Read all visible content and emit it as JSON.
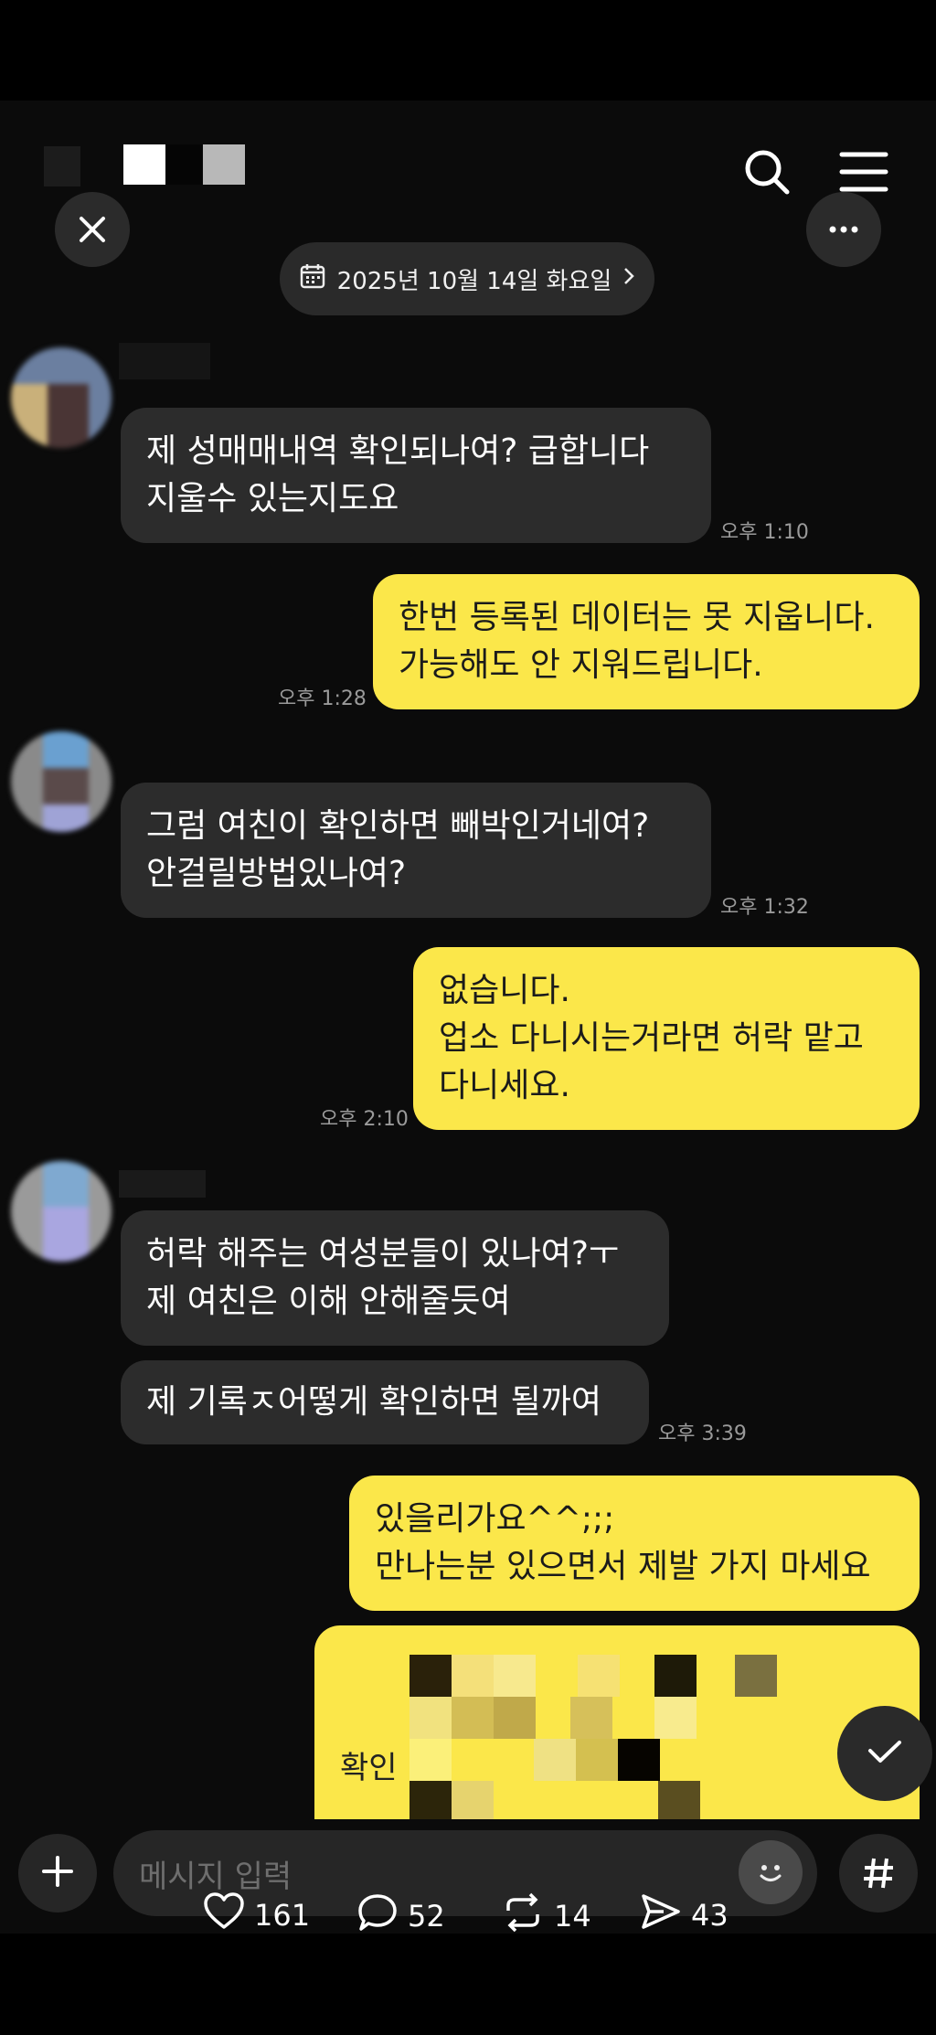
{
  "header": {
    "close_icon": "close-icon",
    "search_icon": "search-icon",
    "menu_icon": "hamburger-menu-icon",
    "more_icon": "more-dots-icon"
  },
  "date_pill": {
    "label": "2025년 10월 14일 화요일",
    "icon": "calendar-icon"
  },
  "messages": [
    {
      "side": "in",
      "lines": [
        "제 성매매내역 확인되나여? 급합니다",
        "지울수 있는지도요"
      ],
      "time": "오후 1:10"
    },
    {
      "side": "out",
      "lines": [
        "한번 등록된 데이터는 못 지웁니다.",
        "가능해도 안 지워드립니다."
      ],
      "time": "오후 1:28"
    },
    {
      "side": "in",
      "lines": [
        "그럼 여친이 확인하면 빼박인거네여?",
        "안걸릴방법있나여?"
      ],
      "time": "오후 1:32"
    },
    {
      "side": "out",
      "lines": [
        "없습니다.",
        "업소 다니시는거라면 허락 맡고",
        "다니세요."
      ],
      "time": "오후 2:10"
    },
    {
      "side": "in",
      "lines": [
        "허락 해주는 여성분들이 있나여?ㅜ",
        "제 여친은 이해 안해줄듯여"
      ],
      "time": ""
    },
    {
      "side": "in",
      "lines": [
        "제 기록ㅈ어떻게 확인하면 될까여"
      ],
      "time": "오후 3:39"
    },
    {
      "side": "out",
      "lines": [
        "있을리가요^^;;;",
        "만나는분 있으면서 제발 가지 마세요"
      ],
      "time": ""
    }
  ],
  "partial_message": {
    "visible_fragment": "확인"
  },
  "composer": {
    "placeholder": "메시지 입력",
    "add_icon": "plus-icon",
    "emoji_icon": "emoji-icon",
    "hash_icon": "hashtag-icon",
    "scroll_icon": "check-chevron-icon"
  },
  "stats": {
    "likes": "161",
    "comments": "52",
    "reposts": "14",
    "shares": "43"
  },
  "colors": {
    "outgoing_bubble": "#fbe74a",
    "incoming_bubble": "#2c2c2c",
    "background": "#0b0b0b"
  }
}
